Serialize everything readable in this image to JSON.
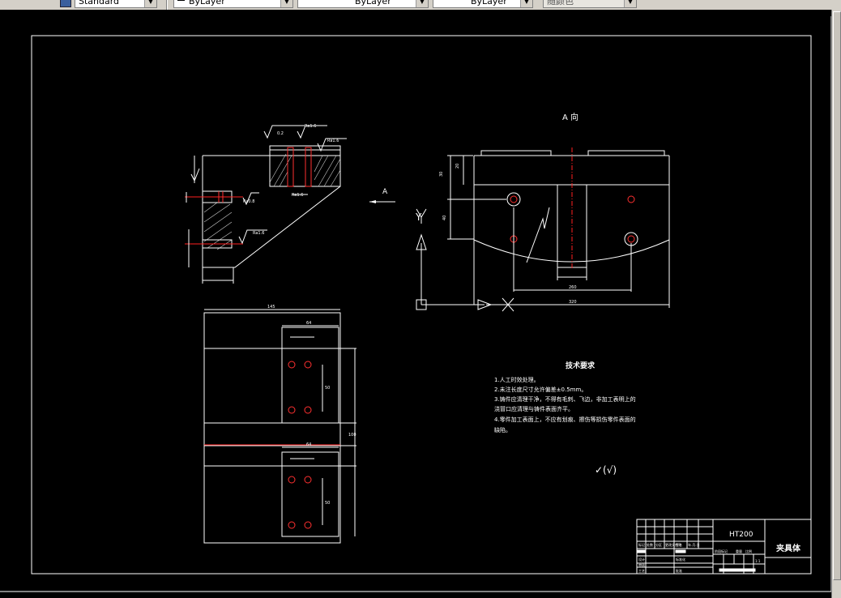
{
  "toolbar": {
    "textstyle_value": "Standard",
    "layer_value": "ByLayer",
    "linetype_value": "ByLayer",
    "lineweight_value": "ByLayer",
    "plotstyle_value": "随颜色"
  },
  "drawing": {
    "view_label": "A 向",
    "arrow_label": "A",
    "axis_y": "Y",
    "dims_section": [
      "0.2",
      "Ra1.6",
      "Ra1.6",
      "Ra1.6",
      "Ra1.6",
      "Ra0.8"
    ],
    "dims_plan": [
      "145",
      "64",
      "64",
      "50",
      "50",
      "100"
    ],
    "dims_view": [
      "30",
      "20",
      "40",
      "260",
      "320"
    ],
    "tech_title": "技术要求",
    "tech_lines": [
      "1.人工时效处理。",
      "2.未注长度尺寸允许偏差±0.5mm。",
      "3.铸件应清理干净，不得有毛刺、飞边，非加工表明上的",
      "浇冒口应清理与铸件表面齐平。",
      "4.零件加工表面上，不应有划痕、擦伤等损伤零件表面的",
      "缺陷。"
    ],
    "roughness_note": "✓(√)"
  },
  "titleblock": {
    "material": "HT200",
    "part_name": "夹具体",
    "labels": [
      "标记",
      "处数",
      "分区",
      "更改文件号",
      "签名",
      "年.月.日",
      "阶段标记",
      "重量",
      "比例",
      "设计",
      "标准化",
      "审核",
      "工艺",
      "批准"
    ],
    "scale": "1:1"
  },
  "colors": {
    "line": "#ffffff",
    "center": "#ff2020",
    "hole": "#ff3030",
    "background": "#000000"
  }
}
